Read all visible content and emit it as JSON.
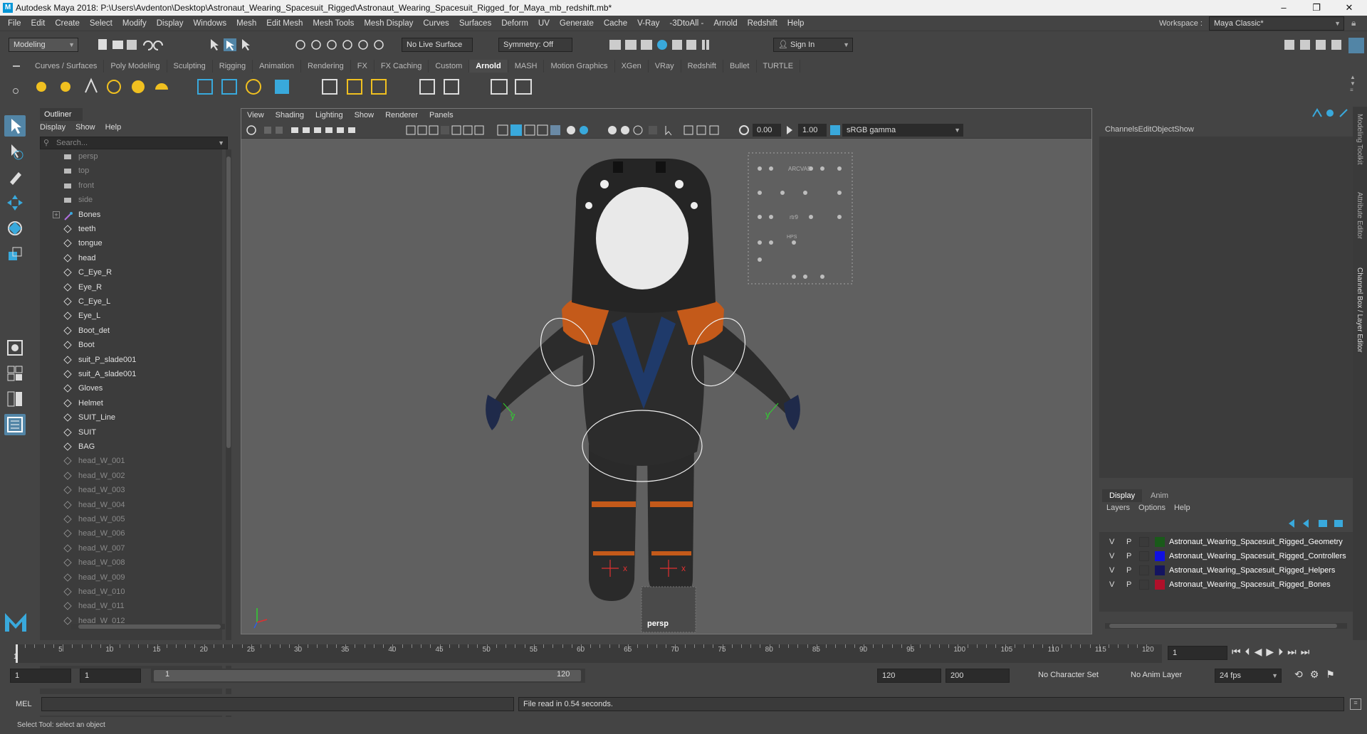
{
  "window": {
    "title": "Autodesk Maya 2018: P:\\Users\\Avdenton\\Desktop\\Astronaut_Wearing_Spacesuit_Rigged\\Astronaut_Wearing_Spacesuit_Rigged_for_Maya_mb_redshift.mb*",
    "logo": "M",
    "minimize": "–",
    "maximize": "❐",
    "close": "✕"
  },
  "menubar": [
    "File",
    "Edit",
    "Create",
    "Select",
    "Modify",
    "Display",
    "Windows",
    "Mesh",
    "Edit Mesh",
    "Mesh Tools",
    "Mesh Display",
    "Curves",
    "Surfaces",
    "Deform",
    "UV",
    "Generate",
    "Cache",
    "V-Ray",
    "-3DtoAll -",
    "Arnold",
    "Redshift",
    "Help"
  ],
  "workspace": {
    "label": "Workspace :",
    "value": "Maya Classic*"
  },
  "statusline": {
    "mode": "Modeling",
    "live_surface": "No Live Surface",
    "symmetry": "Symmetry: Off",
    "sign_in": "Sign In"
  },
  "shelf_tabs": [
    "Curves / Surfaces",
    "Poly Modeling",
    "Sculpting",
    "Rigging",
    "Animation",
    "Rendering",
    "FX",
    "FX Caching",
    "Custom",
    "Arnold",
    "MASH",
    "Motion Graphics",
    "XGen",
    "VRay",
    "Redshift",
    "Bullet",
    "TURTLE"
  ],
  "shelf_active": "Arnold",
  "outliner": {
    "title": "Outliner",
    "menus": [
      "Display",
      "Show",
      "Help"
    ],
    "search_placeholder": "Search...",
    "items": [
      {
        "label": "persp",
        "type": "camera",
        "dim": true
      },
      {
        "label": "top",
        "type": "camera",
        "dim": true
      },
      {
        "label": "front",
        "type": "camera",
        "dim": true
      },
      {
        "label": "side",
        "type": "camera",
        "dim": true
      },
      {
        "label": "Bones",
        "type": "joint",
        "dim": false,
        "expand": true
      },
      {
        "label": "teeth",
        "type": "mesh",
        "dim": false
      },
      {
        "label": "tongue",
        "type": "mesh",
        "dim": false
      },
      {
        "label": "head",
        "type": "mesh",
        "dim": false
      },
      {
        "label": "C_Eye_R",
        "type": "mesh",
        "dim": false
      },
      {
        "label": "Eye_R",
        "type": "mesh",
        "dim": false
      },
      {
        "label": "C_Eye_L",
        "type": "mesh",
        "dim": false
      },
      {
        "label": "Eye_L",
        "type": "mesh",
        "dim": false
      },
      {
        "label": "Boot_det",
        "type": "mesh",
        "dim": false
      },
      {
        "label": "Boot",
        "type": "mesh",
        "dim": false
      },
      {
        "label": "suit_P_slade001",
        "type": "mesh",
        "dim": false
      },
      {
        "label": "suit_A_slade001",
        "type": "mesh",
        "dim": false
      },
      {
        "label": "Gloves",
        "type": "mesh",
        "dim": false
      },
      {
        "label": "Helmet",
        "type": "mesh",
        "dim": false
      },
      {
        "label": "SUIT_Line",
        "type": "mesh",
        "dim": false
      },
      {
        "label": "SUIT",
        "type": "mesh",
        "dim": false
      },
      {
        "label": "BAG",
        "type": "mesh",
        "dim": false
      },
      {
        "label": "head_W_001",
        "type": "mesh",
        "dim": true
      },
      {
        "label": "head_W_002",
        "type": "mesh",
        "dim": true
      },
      {
        "label": "head_W_003",
        "type": "mesh",
        "dim": true
      },
      {
        "label": "head_W_004",
        "type": "mesh",
        "dim": true
      },
      {
        "label": "head_W_005",
        "type": "mesh",
        "dim": true
      },
      {
        "label": "head_W_006",
        "type": "mesh",
        "dim": true
      },
      {
        "label": "head_W_007",
        "type": "mesh",
        "dim": true
      },
      {
        "label": "head_W_008",
        "type": "mesh",
        "dim": true
      },
      {
        "label": "head_W_009",
        "type": "mesh",
        "dim": true
      },
      {
        "label": "head_W_010",
        "type": "mesh",
        "dim": true
      },
      {
        "label": "head_W_011",
        "type": "mesh",
        "dim": true
      },
      {
        "label": "head_W_012",
        "type": "mesh",
        "dim": true
      }
    ]
  },
  "viewport": {
    "menus": [
      "View",
      "Shading",
      "Lighting",
      "Show",
      "Renderer",
      "Panels"
    ],
    "exposure": "0.00",
    "gamma": "1.00",
    "colorspace": "sRGB gamma",
    "camera_label": "persp",
    "axis_x": "x",
    "axis_y": "y",
    "hud_board": [
      "ARCVAE",
      "rtr9",
      "HPS"
    ]
  },
  "channelbox": {
    "menus": [
      "Channels",
      "Edit",
      "Object",
      "Show"
    ]
  },
  "layers": {
    "tabs": [
      "Display",
      "Anim"
    ],
    "menus": [
      "Layers",
      "Options",
      "Help"
    ],
    "rows": [
      {
        "v": "V",
        "p": "P",
        "color": "#1a5a1a",
        "name": "Astronaut_Wearing_Spacesuit_Rigged_Geometry"
      },
      {
        "v": "V",
        "p": "P",
        "color": "#1010e0",
        "name": "Astronaut_Wearing_Spacesuit_Rigged_Controllers"
      },
      {
        "v": "V",
        "p": "P",
        "color": "#141460",
        "name": "Astronaut_Wearing_Spacesuit_Rigged_Helpers"
      },
      {
        "v": "V",
        "p": "P",
        "color": "#b0102a",
        "name": "Astronaut_Wearing_Spacesuit_Rigged_Bones"
      }
    ]
  },
  "side_tabs": [
    "Modeling Toolkit",
    "Attribute Editor",
    "Channel Box / Layer Editor"
  ],
  "timeline": {
    "ticks": [
      "5",
      "10",
      "15",
      "20",
      "25",
      "30",
      "35",
      "40",
      "45",
      "50",
      "55",
      "60",
      "65",
      "70",
      "75",
      "80",
      "85",
      "90",
      "95",
      "100",
      "105",
      "110",
      "115",
      "120"
    ],
    "start_marker": "1",
    "current_frame": "1"
  },
  "range": {
    "start": "1",
    "anim_start": "1",
    "range_start": "1",
    "range_end": "120",
    "anim_end": "120",
    "end": "200",
    "character_set": "No Character Set",
    "anim_layer": "No Anim Layer",
    "fps": "24 fps"
  },
  "command": {
    "lang": "MEL",
    "result": "File read in  0.54 seconds."
  },
  "help_line": "Select Tool: select an object"
}
